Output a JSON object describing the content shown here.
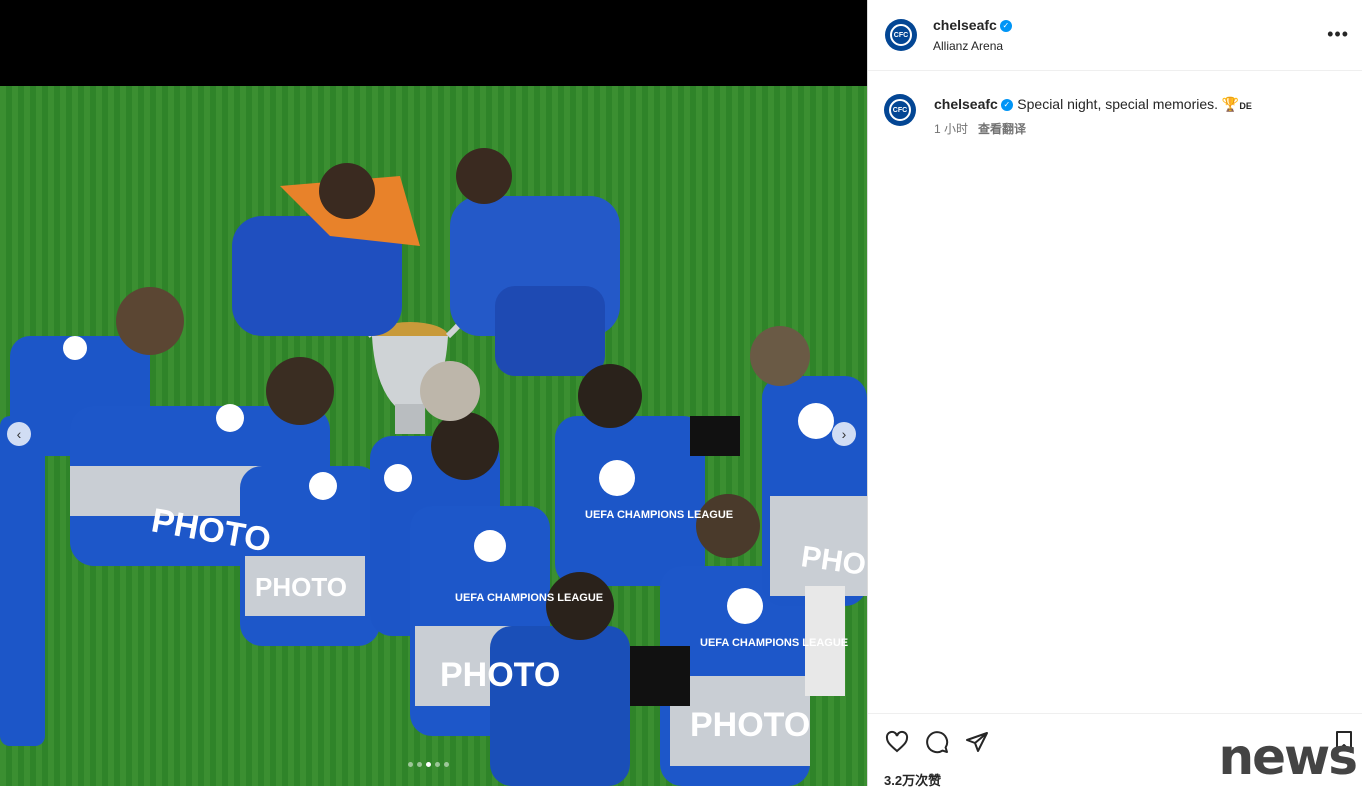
{
  "post": {
    "username": "chelseafc",
    "location": "Allianz Arena",
    "caption_text": "Special night, special memories. 🏆",
    "caption_tail": "DE",
    "time": "1 小时",
    "translate_label": "查看翻译",
    "likes": "3.2万次赞"
  },
  "media": {
    "vest_text": "PHOTO",
    "vest_badge": "UEFA CHAMPIONS LEAGUE",
    "carousel_count": 5,
    "carousel_active": 2
  },
  "watermark": "news",
  "icons": {
    "avatar": "chelsea-crest-icon",
    "verified": "verified-badge-icon",
    "more": "more-options-icon",
    "like": "heart-icon",
    "comment": "comment-icon",
    "share": "share-icon",
    "save": "bookmark-icon",
    "prev": "chevron-left-icon",
    "next": "chevron-right-icon"
  },
  "colors": {
    "brand": "#034694",
    "verified": "#0095f6"
  }
}
